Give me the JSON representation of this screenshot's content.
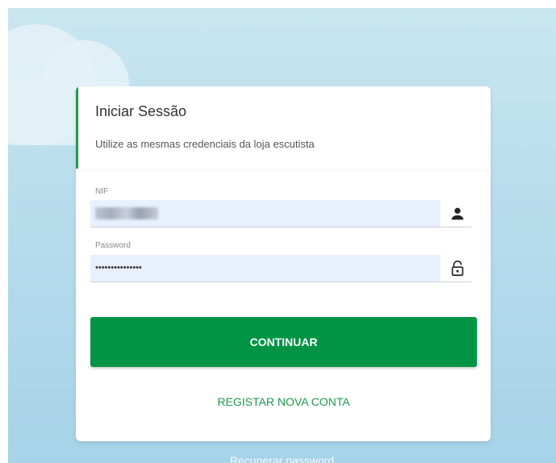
{
  "login": {
    "title": "Iniciar Sessão",
    "subtitle": "Utilize as mesmas credenciais da loja escutista",
    "nif_label": "NIF",
    "password_label": "Password",
    "password_masked": "•••••••••••••••",
    "continue_label": "CONTINUAR",
    "register_label": "REGISTAR NOVA CONTA",
    "recover_label": "Recuperar password"
  },
  "icons": {
    "nif": "user-icon",
    "password": "lock-icon"
  },
  "colors": {
    "primary": "#009444",
    "accent": "#1e9a4b",
    "input_bg": "#e8f0fe"
  }
}
